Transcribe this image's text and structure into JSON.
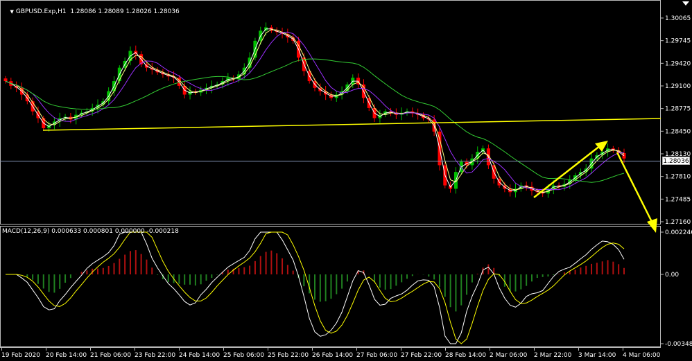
{
  "window": {
    "symbol_title": "GBPUSD.Exp,H1  1.28086 1.28089 1.28026 1.28036",
    "current_price": "1.28036"
  },
  "macd": {
    "title": "MACD(12,26,9) 0.000633 0.000801 0.000000 -0.000218"
  },
  "price_axis": [
    "1.30065",
    "1.29745",
    "1.29420",
    "1.29100",
    "1.28775",
    "1.28450",
    "1.28130",
    "1.27810",
    "1.27485",
    "1.27160"
  ],
  "macd_axis": [
    "0.002246",
    "0.00",
    "-0.003487"
  ],
  "time_axis": [
    "19 Feb 2020",
    "20 Feb 14:00",
    "21 Feb 06:00",
    "23 Feb 22:00",
    "24 Feb 14:00",
    "25 Feb 06:00",
    "25 Feb 22:00",
    "26 Feb 14:00",
    "27 Feb 06:00",
    "27 Feb 22:00",
    "28 Feb 14:00",
    "2 Mar 06:00",
    "2 Mar 22:00",
    "3 Mar 14:00",
    "4 Mar 06:00"
  ],
  "colors": {
    "background": "#000000",
    "bull_candle": "#00c000",
    "bear_candle": "#ff0000",
    "ma_fast": "#ffffff",
    "ma_mid": "#ffff80",
    "ma_slow": "#9b30ff",
    "ma_long": "#33cc33",
    "trendline": "#ffff00",
    "arrow": "#ffff00",
    "hist_pos": "#b01010",
    "hist_neg": "#208020",
    "macd_line": "#ffffff",
    "signal_line": "#ffff00",
    "price_line": "#8899bb"
  },
  "chart_data": {
    "type": "candlestick",
    "symbol": "GBPUSD.Exp",
    "timeframe": "H1",
    "price_range": [
      1.2716,
      1.3025
    ],
    "closes": [
      1.2925,
      1.2918,
      1.2915,
      1.2905,
      1.2895,
      1.288,
      1.287,
      1.2855,
      1.286,
      1.2865,
      1.287,
      1.2872,
      1.2868,
      1.2875,
      1.2878,
      1.288,
      1.2885,
      1.289,
      1.2895,
      1.291,
      1.2925,
      1.2945,
      1.2955,
      1.297,
      1.2965,
      1.295,
      1.2945,
      1.2942,
      1.2938,
      1.2935,
      1.2932,
      1.293,
      1.2918,
      1.2905,
      1.291,
      1.2908,
      1.2912,
      1.2915,
      1.2918,
      1.292,
      1.2925,
      1.293,
      1.2928,
      1.2935,
      1.2945,
      1.296,
      1.2985,
      1.3,
      1.3005,
      1.3,
      1.2998,
      1.2995,
      1.299,
      1.2985,
      1.296,
      1.294,
      1.2925,
      1.2915,
      1.291,
      1.2905,
      1.29,
      1.2905,
      1.291,
      1.292,
      1.293,
      1.292,
      1.29,
      1.2885,
      1.287,
      1.2875,
      1.288,
      1.2878,
      1.2875,
      1.2878,
      1.288,
      1.2877,
      1.2875,
      1.287,
      1.2868,
      1.285,
      1.28,
      1.277,
      1.2765,
      1.279,
      1.2805,
      1.28,
      1.281,
      1.282,
      1.2825,
      1.28,
      1.278,
      1.277,
      1.2765,
      1.276,
      1.2765,
      1.277,
      1.2768,
      1.2762,
      1.276,
      1.2758,
      1.2765,
      1.277,
      1.2768,
      1.2772,
      1.2778,
      1.2785,
      1.279,
      1.2795,
      1.281,
      1.2815,
      1.282,
      1.2825,
      1.2822,
      1.2818,
      1.281
    ],
    "ma_periods": "fast / mid / slow / long moving averages (values not printed)",
    "macd_range": [
      -0.003487,
      0.002246
    ],
    "annotations": [
      "horizontal support trendline",
      "upward channel arrow",
      "downward projection arrow"
    ]
  }
}
